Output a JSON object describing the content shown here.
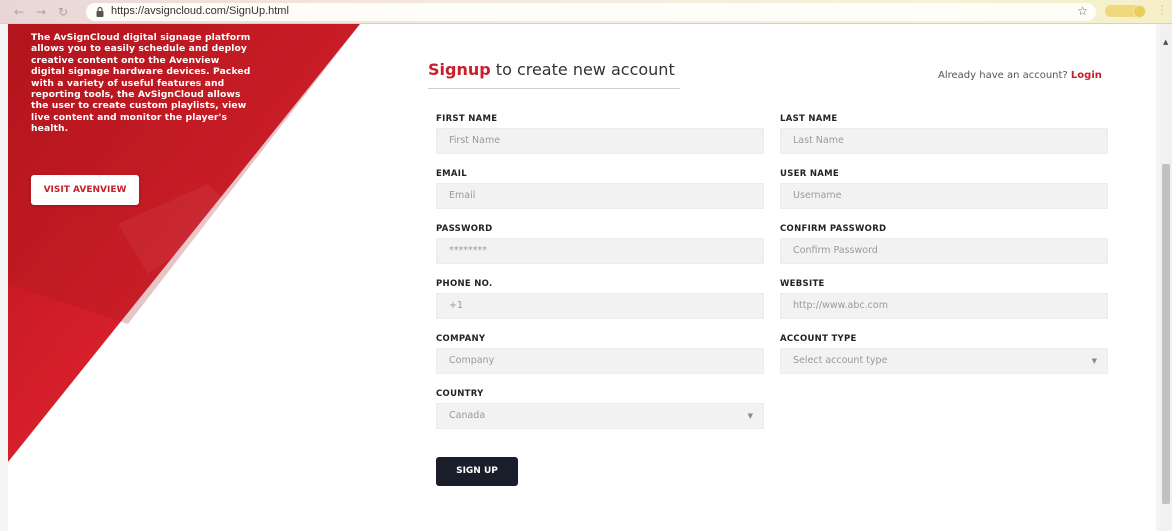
{
  "browser": {
    "url": "https://avsigncloud.com/SignUp.html",
    "back_icon": "arrow-left",
    "forward_icon": "arrow-right",
    "reload_icon": "reload"
  },
  "intro": {
    "text": "The AvSignCloud digital signage platform allows you to easily schedule and deploy creative content onto the Avenview digital signage hardware devices. Packed with a variety of useful features and reporting tools, the AvSignCloud allows the user to create custom playlists, view live content and monitor the player's health.",
    "visit_button": "VISIT AVENVIEW"
  },
  "header": {
    "title_accent": "Signup",
    "title_rest": " to create new account",
    "already_text": "Already have an account? ",
    "login_link": "Login"
  },
  "form": {
    "first_name": {
      "label": "FIRST NAME",
      "placeholder": "First Name"
    },
    "last_name": {
      "label": "LAST NAME",
      "placeholder": "Last Name"
    },
    "email": {
      "label": "EMAIL",
      "placeholder": "Email"
    },
    "user_name": {
      "label": "USER NAME",
      "placeholder": "Username"
    },
    "password": {
      "label": "PASSWORD",
      "value": "********"
    },
    "confirm_password": {
      "label": "CONFIRM PASSWORD",
      "placeholder": "Confirm Password"
    },
    "phone": {
      "label": "PHONE NO.",
      "value": "+1"
    },
    "website": {
      "label": "WEBSITE",
      "placeholder": "http://www.abc.com"
    },
    "company": {
      "label": "COMPANY",
      "placeholder": "Company"
    },
    "account_type": {
      "label": "ACCOUNT TYPE",
      "value": "Select account type"
    },
    "country": {
      "label": "COUNTRY",
      "value": "Canada"
    },
    "submit": "SIGN UP"
  },
  "colors": {
    "accent": "#c8202b",
    "button_dark": "#1a1e2b"
  }
}
